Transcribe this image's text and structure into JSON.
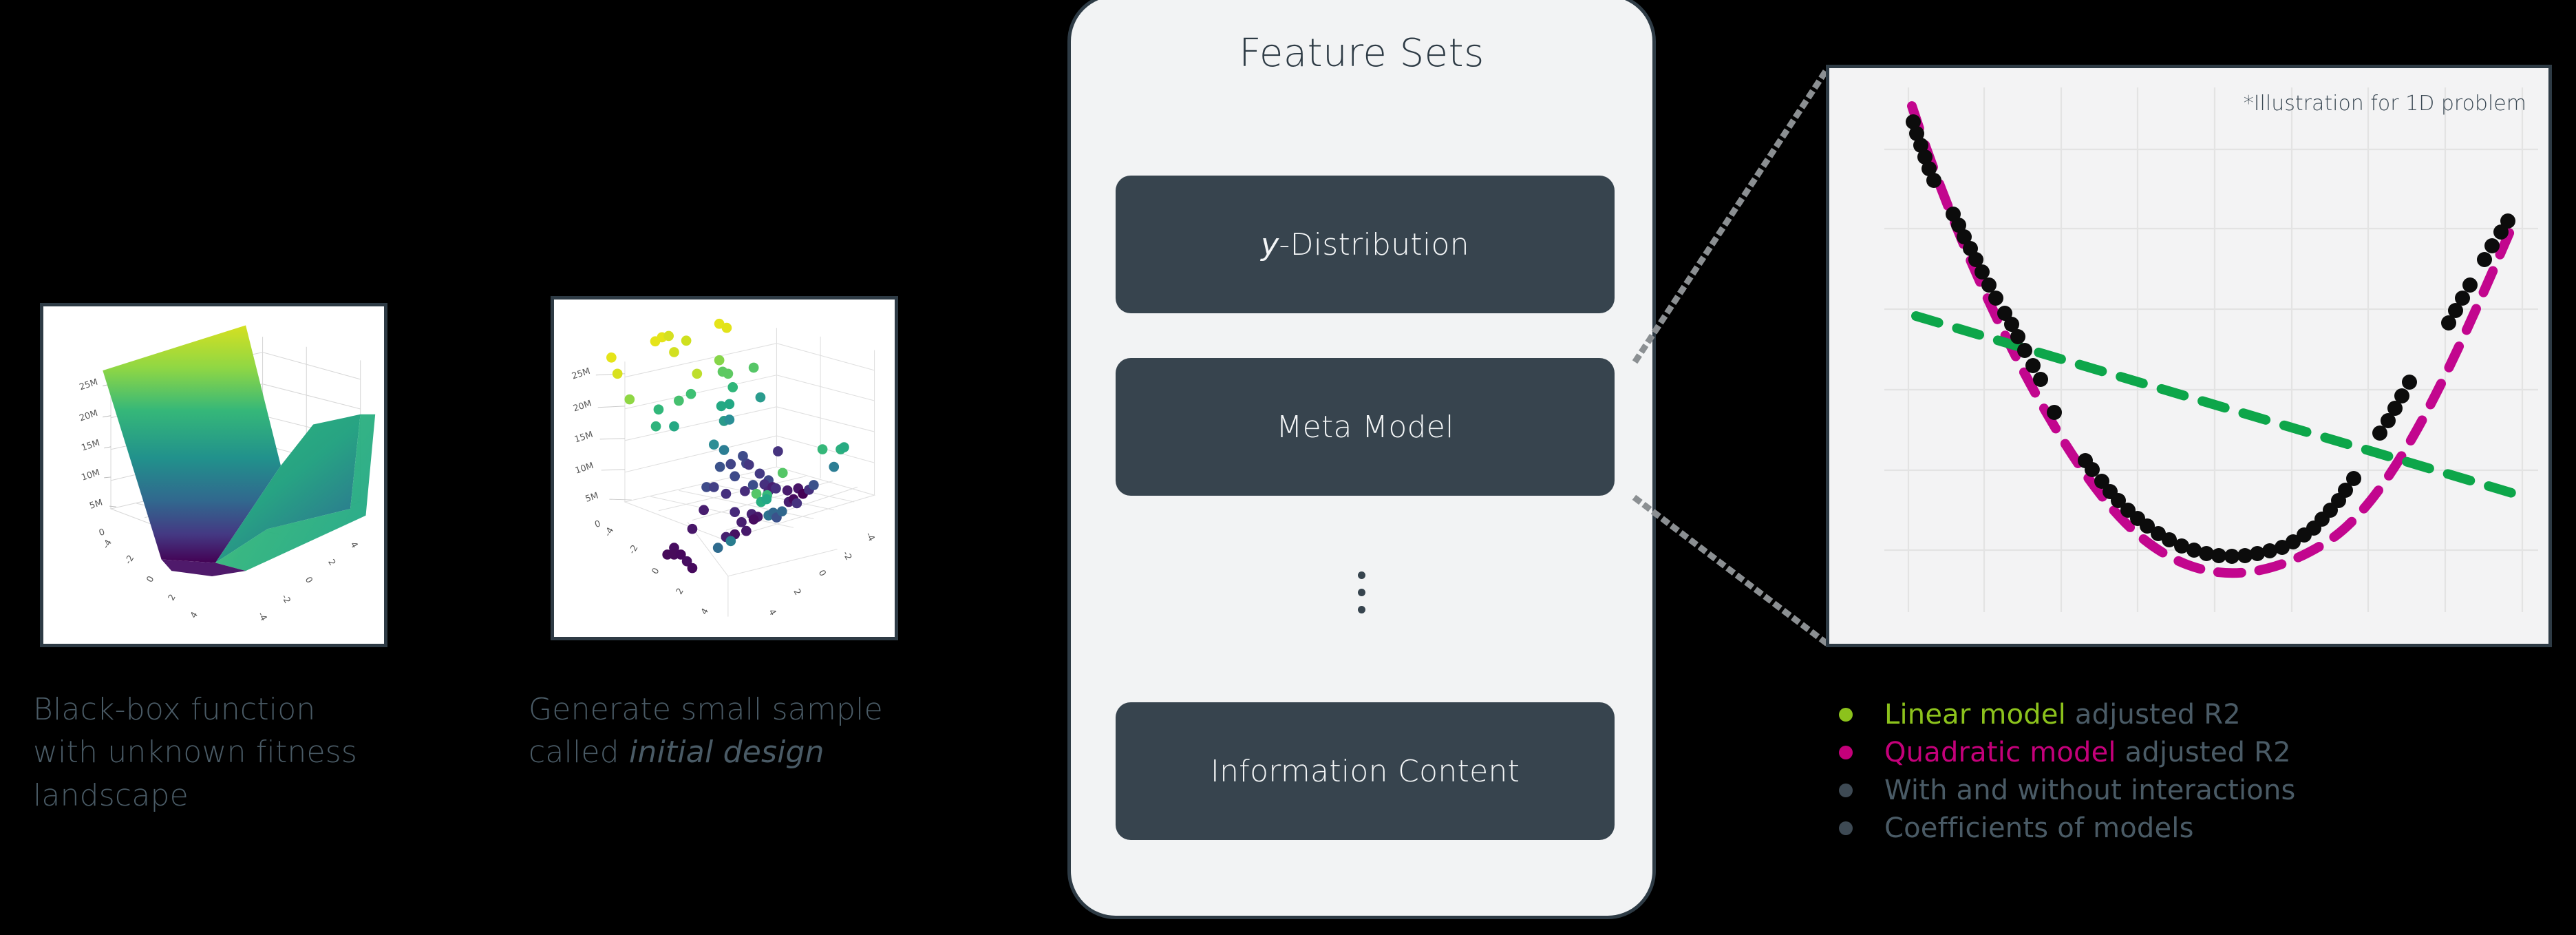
{
  "background_color": "#000000",
  "accent": {
    "dark_slate": "#2e3b45",
    "box_fill": "#37444e",
    "panel_fill": "#f2f3f4",
    "caption_text": "#4a5b66",
    "linear_green": "#8CC21C",
    "quadratic_magenta": "#C4007A",
    "curve_magenta": "#C2068E",
    "line_green": "#0DA64A",
    "muted_gray": "#4a5b66"
  },
  "panels": {
    "surface_plot": {
      "name": "3D black-box fitness landscape surface",
      "caption_lines": [
        "Black-box function",
        "with unknown fitness",
        "landscape"
      ]
    },
    "scatter_plot": {
      "name": "3D initial-design sample scatter",
      "caption_pre": "Generate small sample",
      "caption_post_plain": "called ",
      "caption_post_italic": "initial design"
    }
  },
  "feature_sets": {
    "title": "Feature Sets",
    "boxes": [
      {
        "label_italic": "y",
        "label_rest": "-Distribution"
      },
      {
        "label_italic": "",
        "label_rest": "Meta Model"
      },
      {
        "label_italic": "",
        "label_rest": "Information Content"
      }
    ],
    "ellipsis_icon": "vertical-ellipsis"
  },
  "detail": {
    "note": "*Illustration for 1D problem",
    "legend": [
      {
        "bullet_color": "#8CC21C",
        "strong": "Linear model",
        "rest": " adjusted R2",
        "strong_color": "#8CC21C",
        "rest_color": "#4a5b66"
      },
      {
        "bullet_color": "#C4007A",
        "strong": "Quadratic model",
        "rest": " adjusted R2",
        "strong_color": "#C4007A",
        "rest_color": "#4a5b66"
      },
      {
        "bullet_color": "#3E4A54",
        "strong": "",
        "rest": "With and without interactions",
        "strong_color": "#4a5b66",
        "rest_color": "#4a5b66"
      },
      {
        "bullet_color": "#3E4A54",
        "strong": "",
        "rest": "Coefficients of models",
        "strong_color": "#4a5b66",
        "rest_color": "#4a5b66"
      }
    ]
  },
  "chart_data": {
    "type": "scatter",
    "title": "",
    "subtitle": "*Illustration for 1D problem",
    "xlabel": "",
    "ylabel": "",
    "xlim": [
      0,
      100
    ],
    "ylim": [
      0,
      100
    ],
    "grid": true,
    "legend_position": "below-plot",
    "series": [
      {
        "name": "Sample points",
        "type": "scatter",
        "color": "#111111",
        "x": [
          3,
          4,
          5,
          6,
          7,
          9,
          11,
          13,
          15,
          17,
          19,
          21,
          22,
          24,
          25,
          27,
          29,
          31,
          33,
          35,
          37,
          39,
          41,
          43,
          45,
          47,
          49,
          51,
          53,
          55,
          57,
          59,
          61,
          63,
          65,
          67,
          69,
          71,
          73,
          75,
          77,
          79,
          81,
          83,
          85,
          87,
          89,
          91,
          93,
          95,
          97
        ],
        "y": [
          93,
          91,
          89,
          87,
          85,
          80,
          76,
          72,
          69,
          65,
          62,
          58,
          56,
          53,
          50,
          46,
          43,
          40,
          36,
          33,
          30,
          27,
          24,
          21,
          19,
          17,
          15,
          13,
          12,
          11,
          10,
          10,
          10,
          10,
          11,
          12,
          14,
          16,
          19,
          22,
          26,
          30,
          35,
          40,
          46,
          52,
          59,
          66,
          74,
          82,
          90
        ]
      },
      {
        "name": "Quadratic model",
        "type": "line",
        "style": "dashed",
        "color": "#C2068E",
        "x": [
          2,
          10,
          20,
          30,
          40,
          50,
          60,
          70,
          80,
          90,
          98
        ],
        "y": [
          95,
          80,
          62,
          45,
          30,
          18,
          11,
          15,
          29,
          54,
          92
        ]
      },
      {
        "name": "Linear model",
        "type": "line",
        "style": "dashed",
        "color": "#0DA64A",
        "x": [
          4,
          98
        ],
        "y": [
          60,
          22
        ]
      }
    ],
    "annotations": [
      {
        "text": "*Illustration for 1D problem",
        "x": 62,
        "y": 96
      }
    ]
  },
  "surface_chart_data": {
    "type": "surface",
    "title": "",
    "colormap": "viridis",
    "z_ticks": [
      "0",
      "5M",
      "10M",
      "15M",
      "20M",
      "25M"
    ],
    "x_ticks": [
      "-4",
      "-2",
      "0",
      "2",
      "4"
    ],
    "y_ticks": [
      "-4",
      "-2",
      "0",
      "2",
      "4"
    ],
    "zlim": [
      0,
      28000000
    ],
    "description": "Steep valley / parabolic ridge black-box fitness landscape"
  },
  "scatter3d_chart_data": {
    "type": "scatter",
    "title": "",
    "colormap": "viridis",
    "z_ticks": [
      "0",
      "5M",
      "10M",
      "15M",
      "20M",
      "25M"
    ],
    "x_ticks": [
      "-4",
      "-2",
      "0",
      "2",
      "4"
    ],
    "y_ticks": [
      "-4",
      "-2",
      "0",
      "2",
      "4"
    ],
    "zlim": [
      0,
      28000000
    ],
    "n_points": 100,
    "description": "Small initial design sample drawn from the black-box landscape"
  }
}
